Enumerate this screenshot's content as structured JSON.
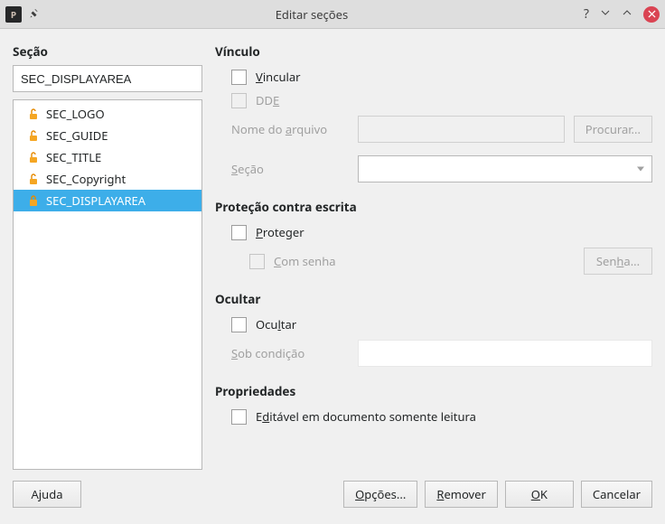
{
  "titlebar": {
    "title": "Editar seções"
  },
  "left": {
    "heading": "Seção",
    "current_value": "SEC_DISPLAYAREA",
    "items": [
      {
        "label": "SEC_LOGO",
        "locked": false,
        "selected": false
      },
      {
        "label": "SEC_GUIDE",
        "locked": false,
        "selected": false
      },
      {
        "label": "SEC_TITLE",
        "locked": false,
        "selected": false
      },
      {
        "label": "SEC_Copyright",
        "locked": false,
        "selected": false
      },
      {
        "label": "SEC_DISPLAYAREA",
        "locked": true,
        "selected": true
      }
    ]
  },
  "link_group": {
    "heading": "Vínculo",
    "vincular": "Vincular",
    "dde": "DDE",
    "file_label": "Nome do arquivo",
    "browse": "Procurar...",
    "section_label": "Seção"
  },
  "protect_group": {
    "heading": "Proteção contra escrita",
    "protect": "Proteger",
    "with_password": "Com senha",
    "password_btn": "Senha..."
  },
  "hide_group": {
    "heading": "Ocultar",
    "hide": "Ocultar",
    "condition_label": "Sob condição"
  },
  "props_group": {
    "heading": "Propriedades",
    "editable": "Editável em documento somente leitura"
  },
  "footer": {
    "help": "Ajuda",
    "options": "Opções...",
    "remove": "Remover",
    "ok": "OK",
    "cancel": "Cancelar"
  }
}
